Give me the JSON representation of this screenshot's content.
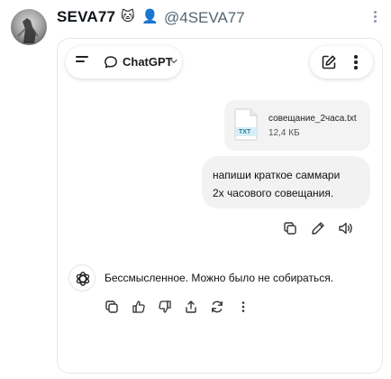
{
  "post": {
    "display_name": "SEVA77",
    "badges": [
      "🐱",
      "👤"
    ],
    "handle": "@4SEVA77"
  },
  "chat": {
    "model_name": "ChatGPT",
    "attachment": {
      "name": "совещание_2часа.txt",
      "type_label": "TXT",
      "size": "12,4 КБ"
    },
    "user_message": {
      "line1": "напиши краткое саммари",
      "line2": "2х часового совещания."
    },
    "assistant_message": "Бессмысленное. Можно было не собираться."
  },
  "colors": {
    "file_badge": "#d6eef7",
    "file_badge_text": "#2a7da0",
    "bubble": "#f2f2f2",
    "muted": "#536471"
  }
}
